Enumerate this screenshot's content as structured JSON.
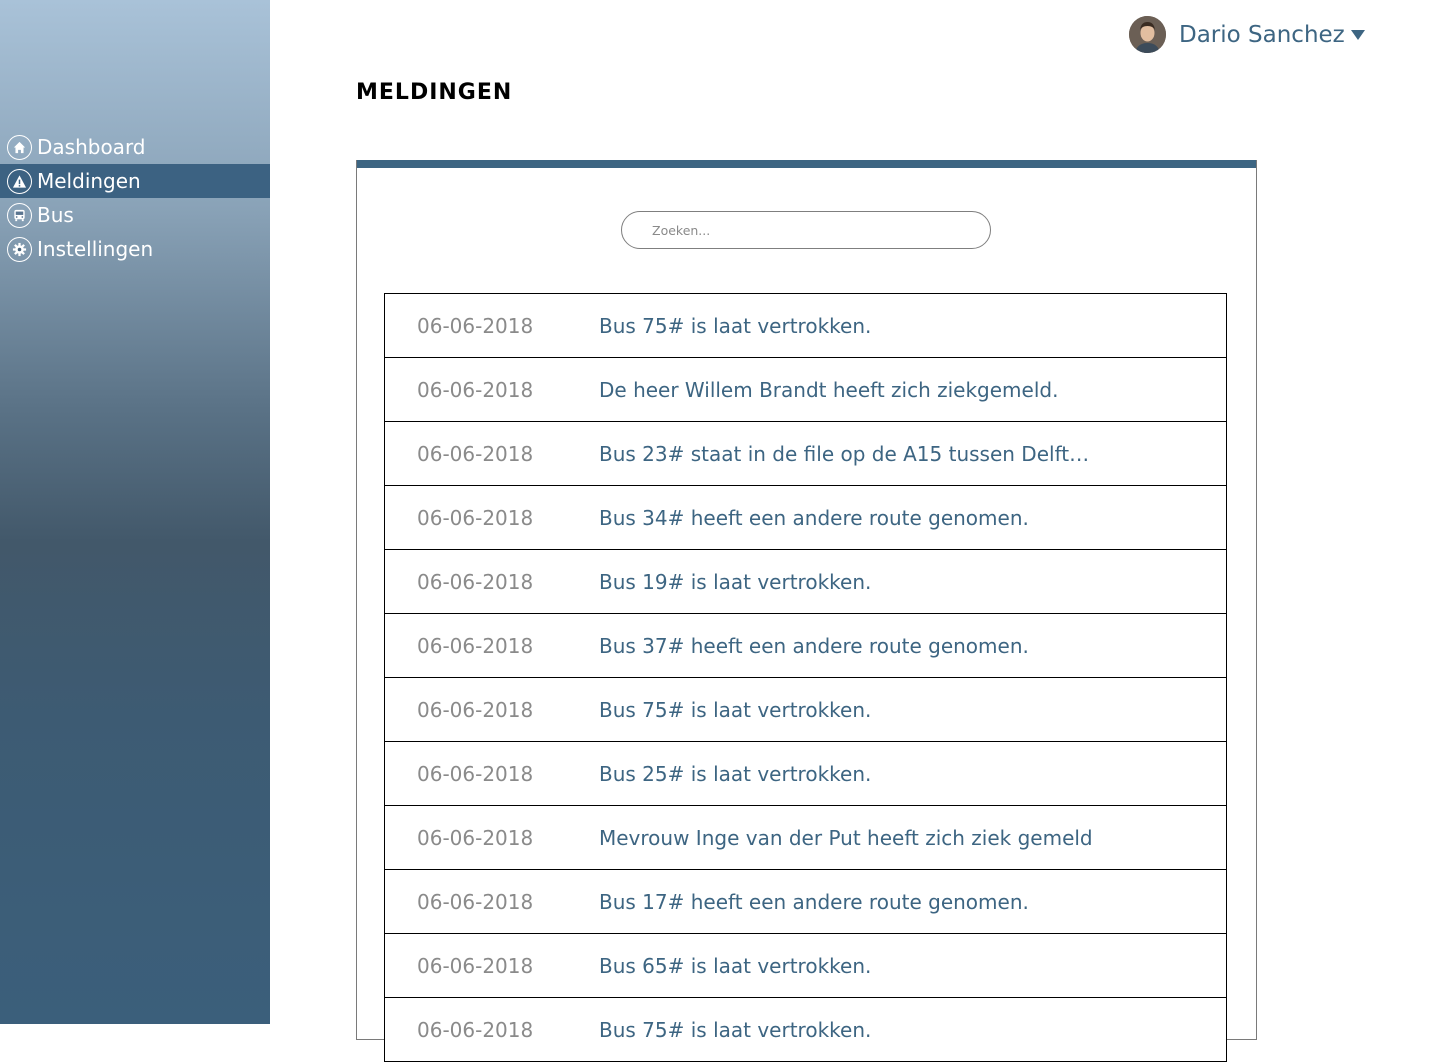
{
  "user": {
    "name": "Dario Sanchez"
  },
  "page": {
    "title": "MELDINGEN"
  },
  "sidebar": {
    "items": [
      {
        "label": "Dashboard",
        "icon": "home-icon",
        "active": false
      },
      {
        "label": "Meldingen",
        "icon": "warning-icon",
        "active": true
      },
      {
        "label": "Bus",
        "icon": "bus-icon",
        "active": false
      },
      {
        "label": "Instellingen",
        "icon": "gear-icon",
        "active": false
      }
    ]
  },
  "search": {
    "placeholder": "Zoeken..."
  },
  "notifications": [
    {
      "date": "06-06-2018",
      "message": "Bus 75# is laat vertrokken."
    },
    {
      "date": "06-06-2018",
      "message": "De heer Willem Brandt heeft zich ziekgemeld."
    },
    {
      "date": "06-06-2018",
      "message": "Bus 23# staat in de file op de  A15 tussen Delft…"
    },
    {
      "date": "06-06-2018",
      "message": "Bus 34# heeft een andere route genomen."
    },
    {
      "date": "06-06-2018",
      "message": "Bus 19# is laat vertrokken."
    },
    {
      "date": "06-06-2018",
      "message": "Bus 37# heeft een andere route genomen."
    },
    {
      "date": "06-06-2018",
      "message": "Bus 75# is laat vertrokken."
    },
    {
      "date": "06-06-2018",
      "message": "Bus 25# is laat vertrokken."
    },
    {
      "date": "06-06-2018",
      "message": "Mevrouw Inge van der Put heeft zich ziek gemeld"
    },
    {
      "date": "06-06-2018",
      "message": "Bus 17# heeft een andere route genomen."
    },
    {
      "date": "06-06-2018",
      "message": "Bus 65# is laat vertrokken."
    },
    {
      "date": "06-06-2018",
      "message": "Bus 75# is laat vertrokken."
    }
  ],
  "colors": {
    "accent": "#3d6582",
    "active_nav": "#3c6282",
    "date_text": "#8a8a8a"
  }
}
